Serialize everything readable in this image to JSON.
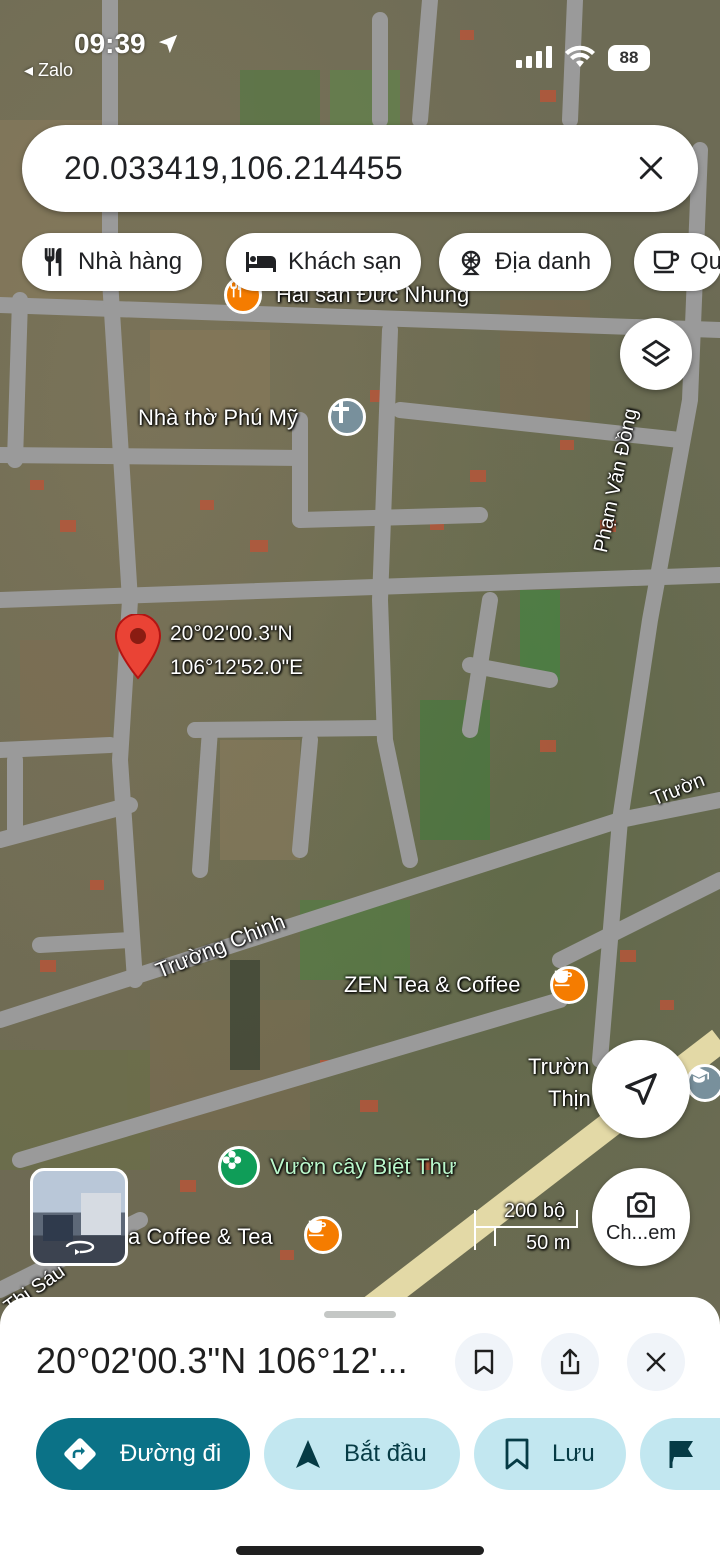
{
  "status_bar": {
    "time": "09:39",
    "back_app": "◂ Zalo",
    "battery": "88"
  },
  "search": {
    "query": "20.033419,106.214455"
  },
  "chips": [
    {
      "label": "Nhà hàng",
      "icon": "restaurant-icon"
    },
    {
      "label": "Khách sạn",
      "icon": "hotel-bed-icon"
    },
    {
      "label": "Địa danh",
      "icon": "landmark-icon"
    },
    {
      "label": "Qu",
      "icon": "coffee-cup-icon"
    }
  ],
  "map": {
    "pin_coords_line1": "20°02'00.3\"N",
    "pin_coords_line2": "106°12'52.0\"E",
    "places": {
      "restaurant": "Hải sản Đức Nhung",
      "church": "Nhà thờ Phú Mỹ",
      "cafe_zen": "ZEN Tea & Coffee",
      "garden": "Vườn cây Biệt Thự",
      "cafe_bottom": "a Coffee & Tea",
      "school": "Trườn",
      "school_line2": "Thịn"
    },
    "roads": {
      "pham_van_dong": "Phạm Văn Đồng",
      "truong_chinh": "Trường Chinh",
      "truong_right": "Trườn",
      "thi_sau": "Thị Sáu"
    },
    "scale": {
      "imperial": "200 bộ",
      "metric": "50 m"
    },
    "camera_label": "Ch...em",
    "colors": {
      "pin": "#ea4335",
      "restaurant_poi": "#f57c00",
      "church_poi": "#78909c",
      "garden_poi": "#0f9d58"
    }
  },
  "sheet": {
    "title": "20°02'00.3\"N 106°12'...",
    "actions": [
      {
        "label": "Đường đi",
        "icon": "directions-icon",
        "primary": true
      },
      {
        "label": "Bắt đầu",
        "icon": "navigation-arrow-icon",
        "primary": false
      },
      {
        "label": "Lưu",
        "icon": "bookmark-icon",
        "primary": false
      }
    ],
    "colors": {
      "primary": "#0b7287",
      "secondary": "#c2e7f0"
    }
  }
}
